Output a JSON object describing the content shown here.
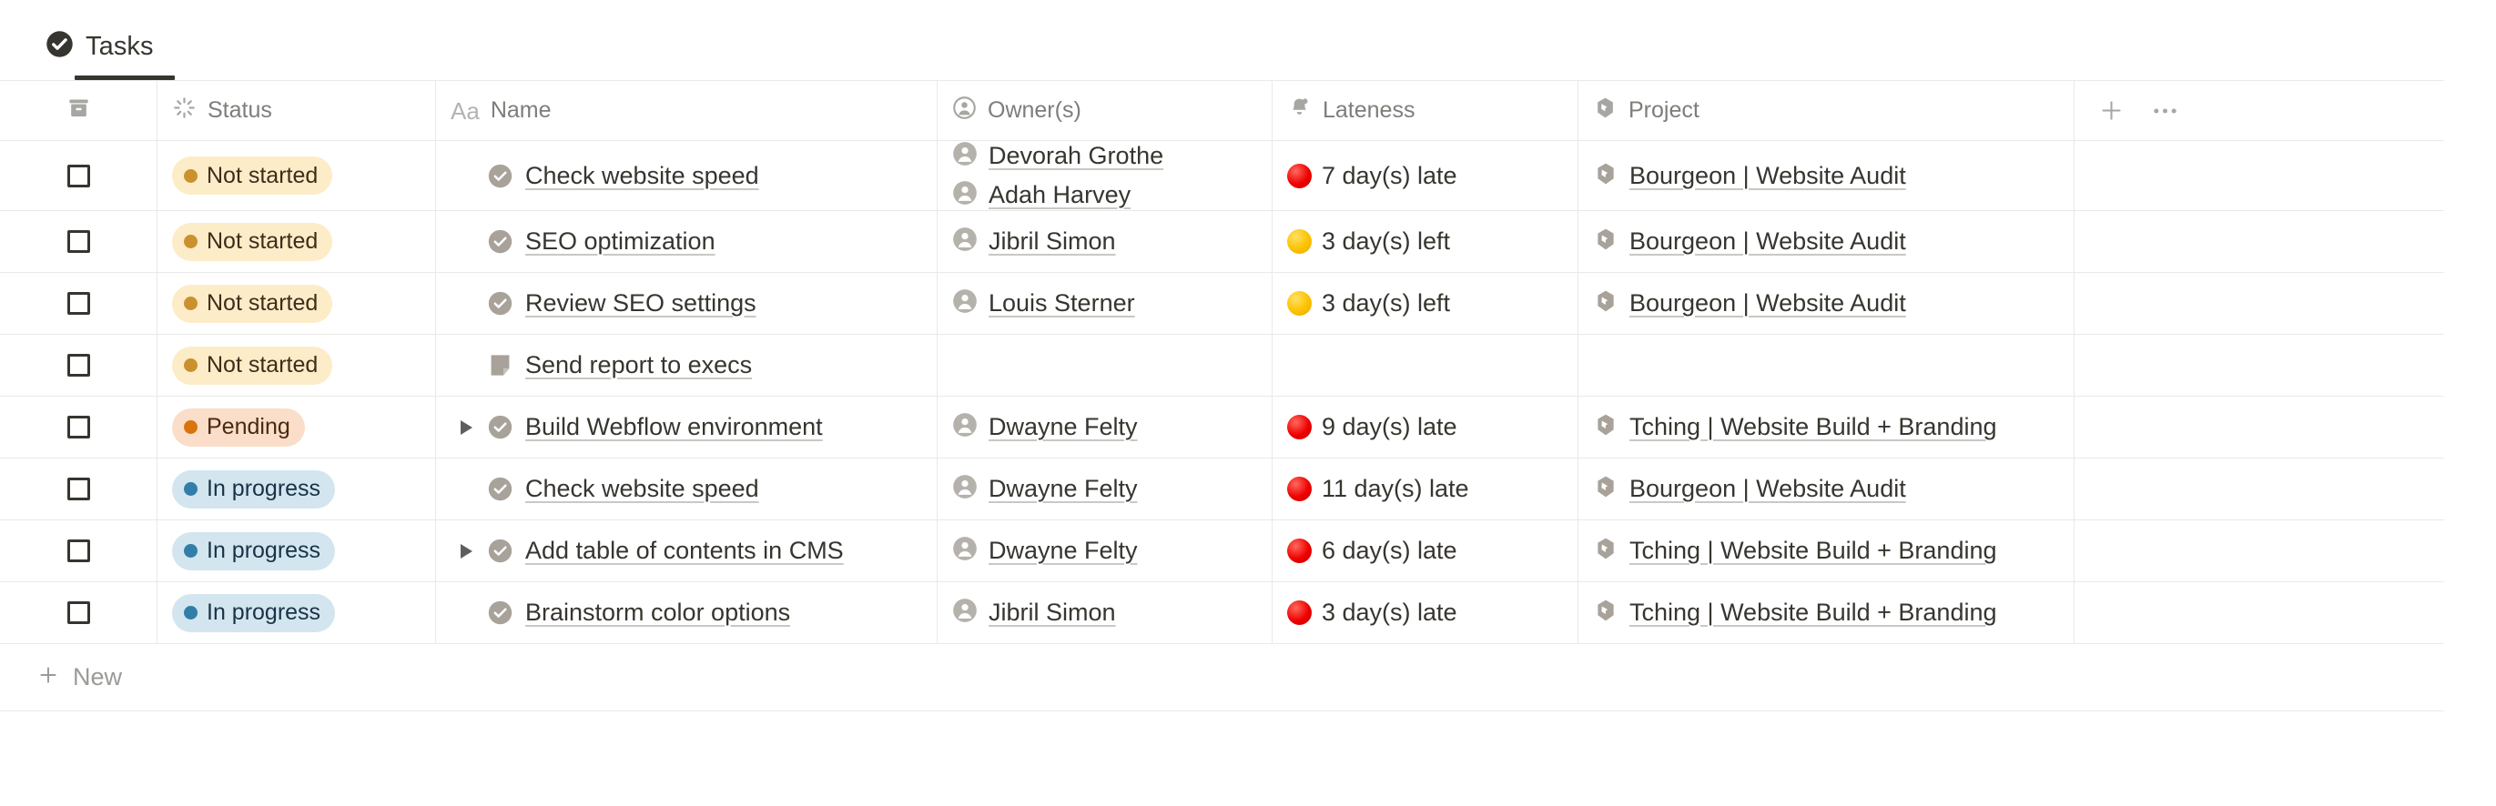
{
  "tab": {
    "label": "Tasks",
    "icon": "check-circle-icon",
    "active": true
  },
  "table": {
    "columns": [
      {
        "key": "check",
        "label": "",
        "icon": "archive-box-icon"
      },
      {
        "key": "status",
        "label": "Status",
        "icon": "spinner-icon"
      },
      {
        "key": "name",
        "label": "Name",
        "icon": "aa-text-icon"
      },
      {
        "key": "owner",
        "label": "Owner(s)",
        "icon": "person-icon"
      },
      {
        "key": "late",
        "label": "Lateness",
        "icon": "bell-icon"
      },
      {
        "key": "project",
        "label": "Project",
        "icon": "relation-cube-icon"
      }
    ],
    "add_column_label": "+",
    "more_options_label": "•••",
    "new_row": {
      "label": "New",
      "icon": "plus-icon"
    },
    "rows": [
      {
        "checked": false,
        "status": {
          "label": "Not started",
          "variant": "notstarted"
        },
        "expandable": false,
        "name_icon": "check-circle-page-icon",
        "name": "Check website speed",
        "owners": [
          "Devorah Grothe",
          "Adah Harvey"
        ],
        "lateness": {
          "text": "7 day(s) late",
          "color": "red"
        },
        "project": "Bourgeon | Website Audit"
      },
      {
        "checked": false,
        "status": {
          "label": "Not started",
          "variant": "notstarted"
        },
        "expandable": false,
        "name_icon": "check-circle-page-icon",
        "name": "SEO optimization",
        "owners": [
          "Jibril Simon"
        ],
        "lateness": {
          "text": "3 day(s) left",
          "color": "yellow"
        },
        "project": "Bourgeon | Website Audit"
      },
      {
        "checked": false,
        "status": {
          "label": "Not started",
          "variant": "notstarted"
        },
        "expandable": false,
        "name_icon": "check-circle-page-icon",
        "name": "Review SEO settings",
        "owners": [
          "Louis Sterner"
        ],
        "lateness": {
          "text": "3 day(s) left",
          "color": "yellow"
        },
        "project": "Bourgeon | Website Audit"
      },
      {
        "checked": false,
        "status": {
          "label": "Not started",
          "variant": "notstarted"
        },
        "expandable": false,
        "name_icon": "document-page-icon",
        "name": "Send report to execs",
        "owners": [],
        "lateness": {
          "text": "",
          "color": ""
        },
        "project": ""
      },
      {
        "checked": false,
        "status": {
          "label": "Pending",
          "variant": "pending"
        },
        "expandable": true,
        "name_icon": "check-circle-page-icon",
        "name": "Build Webflow environment",
        "owners": [
          "Dwayne Felty"
        ],
        "lateness": {
          "text": "9 day(s) late",
          "color": "red"
        },
        "project": "Tching | Website Build + Branding"
      },
      {
        "checked": false,
        "status": {
          "label": "In progress",
          "variant": "inprogress"
        },
        "expandable": false,
        "name_icon": "check-circle-page-icon",
        "name": "Check website speed",
        "owners": [
          "Dwayne Felty"
        ],
        "lateness": {
          "text": "11 day(s) late",
          "color": "red"
        },
        "project": "Bourgeon | Website Audit"
      },
      {
        "checked": false,
        "status": {
          "label": "In progress",
          "variant": "inprogress"
        },
        "expandable": true,
        "name_icon": "check-circle-page-icon",
        "name": "Add table of contents in CMS",
        "owners": [
          "Dwayne Felty"
        ],
        "lateness": {
          "text": "6 day(s) late",
          "color": "red"
        },
        "project": "Tching | Website Build + Branding"
      },
      {
        "checked": false,
        "status": {
          "label": "In progress",
          "variant": "inprogress"
        },
        "expandable": false,
        "name_icon": "check-circle-page-icon",
        "name": "Brainstorm color options",
        "owners": [
          "Jibril Simon"
        ],
        "lateness": {
          "text": "3 day(s) late",
          "color": "red"
        },
        "project": "Tching | Website Build + Branding"
      }
    ]
  },
  "colors": {
    "text": "#37352f",
    "muted": "#91918e",
    "border": "#e9e9e7",
    "status_notstarted_bg": "#fdecc8",
    "status_notstarted_dot": "#cb912f",
    "status_pending_bg": "#fadec9",
    "status_pending_dot": "#d9730d",
    "status_inprogress_bg": "#d3e5ef",
    "status_inprogress_dot": "#337ea9",
    "late_red": "#ee0000",
    "late_yellow": "#fcc200"
  }
}
